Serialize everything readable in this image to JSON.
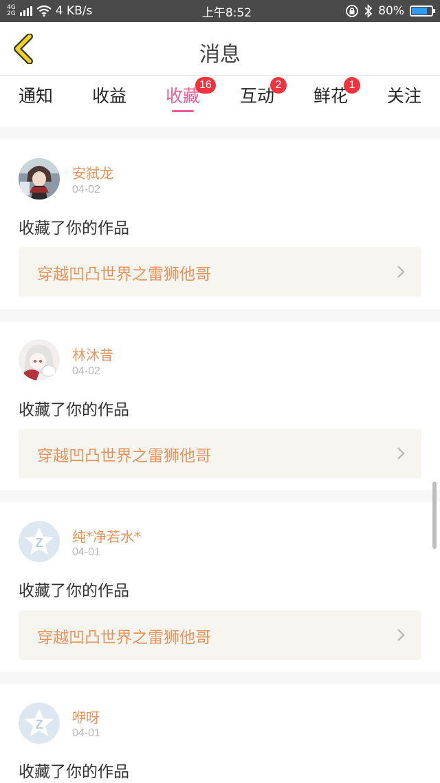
{
  "status_bar": {
    "network_top": "4G",
    "network_bottom": "2G",
    "speed": "4 KB/s",
    "time": "上午8:52",
    "battery": "80%",
    "battery_level": 0.8
  },
  "header": {
    "title": "消息"
  },
  "tabs": [
    {
      "label": "通知",
      "badge": ""
    },
    {
      "label": "收益",
      "badge": ""
    },
    {
      "label": "收藏",
      "badge": "16"
    },
    {
      "label": "互动",
      "badge": "2"
    },
    {
      "label": "鲜花",
      "badge": "1"
    },
    {
      "label": "关注",
      "badge": ""
    }
  ],
  "active_tab": "收藏",
  "items": [
    {
      "user": "安弑龙",
      "date": "04-02",
      "action": "收藏了你的作品",
      "work": "穿越凹凸世界之雷狮他哥",
      "avatar": "anime-boy-avatar"
    },
    {
      "user": "林沐昔",
      "date": "04-02",
      "action": "收藏了你的作品",
      "work": "穿越凹凸世界之雷狮他哥",
      "avatar": "anime-girl-avatar"
    },
    {
      "user": "纯*净若水*",
      "date": "04-01",
      "action": "收藏了你的作品",
      "work": "穿越凹凸世界之雷狮他哥",
      "avatar": "default-star-avatar"
    },
    {
      "user": "咿呀",
      "date": "04-01",
      "action": "收藏了你的作品",
      "work": "",
      "avatar": "default-star-avatar"
    }
  ],
  "colors": {
    "accent_pink": "#ef5c92",
    "username_orange": "#e8935c",
    "badge_red": "#f0343f",
    "back_arrow_yellow": "#f3d21f"
  }
}
